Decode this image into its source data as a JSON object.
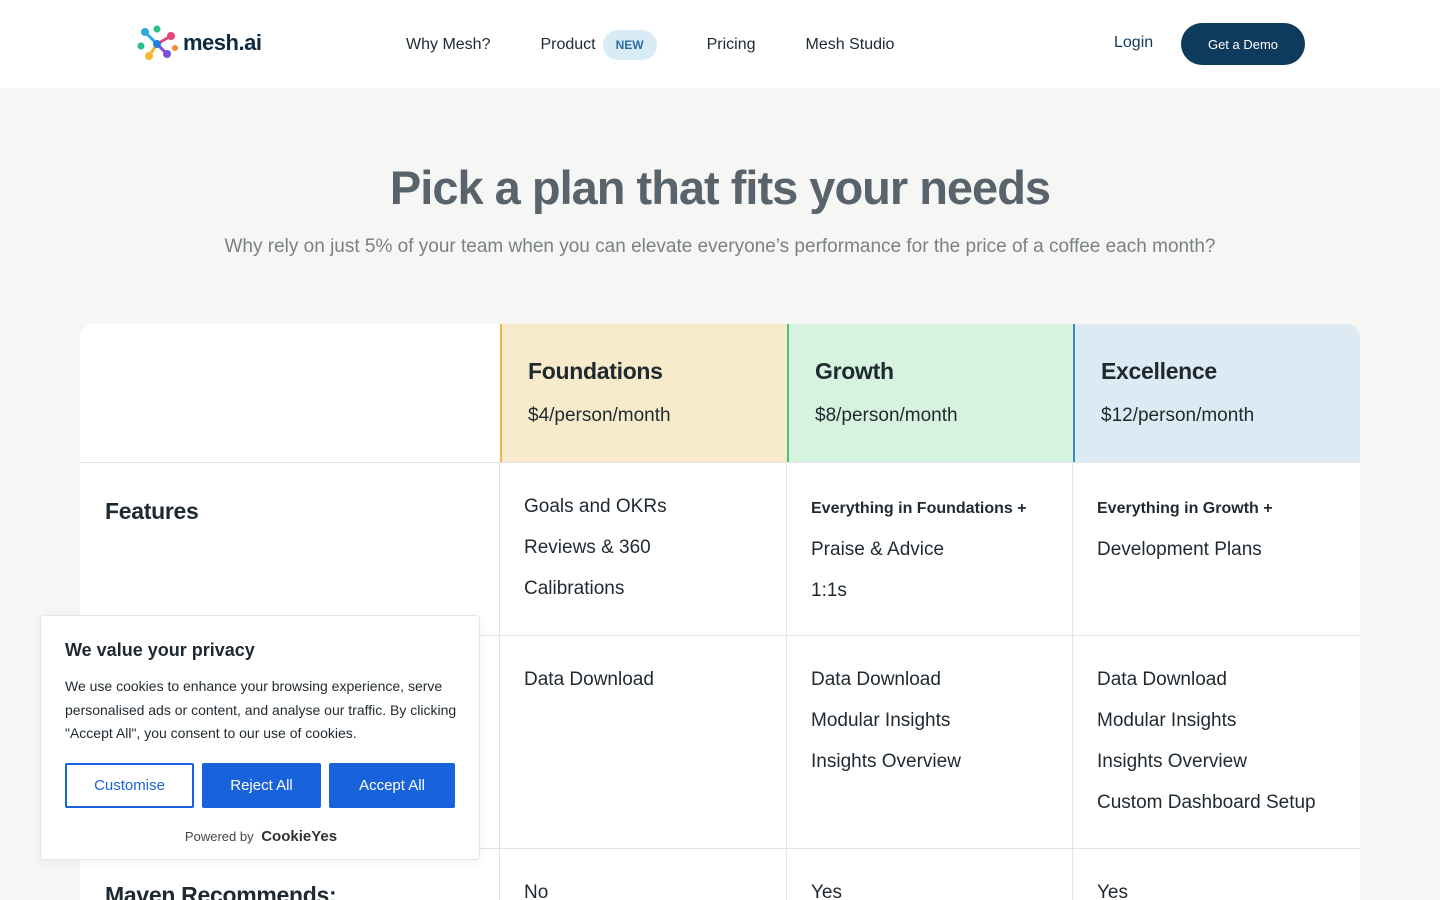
{
  "header": {
    "logo_text": "mesh.ai",
    "nav": [
      {
        "label": "Why Mesh?"
      },
      {
        "label": "Product",
        "badge": "NEW"
      },
      {
        "label": "Pricing"
      },
      {
        "label": "Mesh Studio"
      }
    ],
    "login_label": "Login",
    "demo_label": "Get a Demo"
  },
  "hero": {
    "title": "Pick a plan that fits your needs",
    "subtitle": "Why rely on just 5% of your team when you can elevate everyone’s performance for the price of a coffee each month?"
  },
  "plans": [
    {
      "name": "Foundations",
      "price": "$4/person/month",
      "accent": "#e8b84a",
      "bg": "#f7ebcb"
    },
    {
      "name": "Growth",
      "price": "$8/person/month",
      "accent": "#4cc174",
      "bg": "#d5f3df"
    },
    {
      "name": "Excellence",
      "price": "$12/person/month",
      "accent": "#3a8cc9",
      "bg": "#dde9f3"
    }
  ],
  "rows": [
    {
      "label": "Features",
      "cells": [
        [
          "Goals and OKRs",
          "Reviews & 360",
          "Calibrations"
        ],
        [
          "Everything in Foundations +",
          "Praise & Advice",
          "1:1s"
        ],
        [
          "Everything in Growth +",
          "Development Plans"
        ]
      ]
    },
    {
      "label": "",
      "cells": [
        [
          "Data Download"
        ],
        [
          "Data Download",
          "Modular Insights",
          "Insights Overview"
        ],
        [
          "Data Download",
          "Modular Insights",
          "Insights Overview",
          "Custom Dashboard Setup"
        ]
      ]
    },
    {
      "label": "Maven Recommends:",
      "cells": [
        [
          "No"
        ],
        [
          "Yes"
        ],
        [
          "Yes"
        ]
      ]
    }
  ],
  "cookie": {
    "title": "We value your privacy",
    "text": "We use cookies to enhance your browsing experience, serve personalised ads or content, and analyse our traffic. By clicking \"Accept All\", you consent to our use of cookies.",
    "customise_label": "Customise",
    "reject_label": "Reject All",
    "accept_label": "Accept All",
    "powered_label": "Powered by",
    "powered_brand": "CookieYes"
  },
  "colors": {
    "brand_navy": "#0e3a5c",
    "cookie_blue": "#1863dc"
  }
}
